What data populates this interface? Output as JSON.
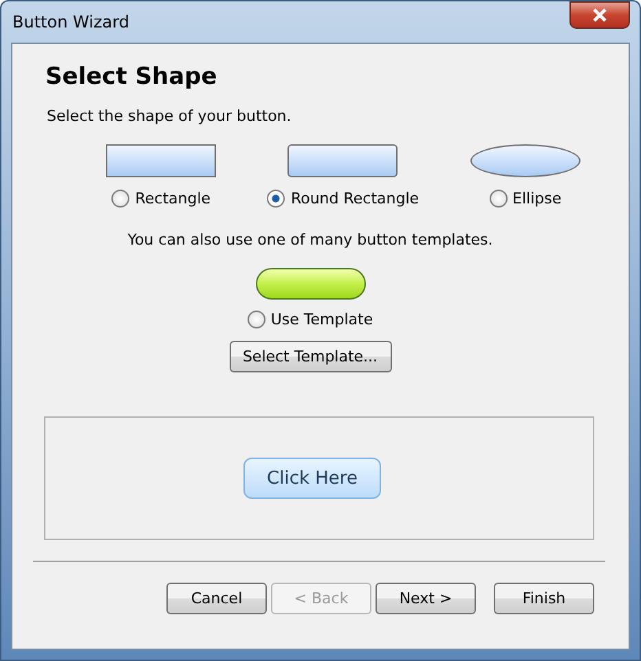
{
  "window": {
    "title": "Button Wizard"
  },
  "heading": "Select Shape",
  "instruction": "Select the shape of your button.",
  "shapes": [
    {
      "kind": "rectangle",
      "label": "Rectangle",
      "selected": false
    },
    {
      "kind": "round",
      "label": "Round Rectangle",
      "selected": true
    },
    {
      "kind": "ellipse",
      "label": "Ellipse",
      "selected": false
    }
  ],
  "template_hint": "You can also use one of many button templates.",
  "template_option": {
    "label": "Use Template",
    "selected": false
  },
  "select_template_button": "Select Template...",
  "preview": {
    "button_label": "Click Here"
  },
  "buttons": [
    {
      "label": "Cancel",
      "disabled": false
    },
    {
      "label": "< Back",
      "disabled": true
    },
    {
      "label": "Next >",
      "disabled": false
    },
    {
      "label": "Finish",
      "disabled": false
    }
  ]
}
